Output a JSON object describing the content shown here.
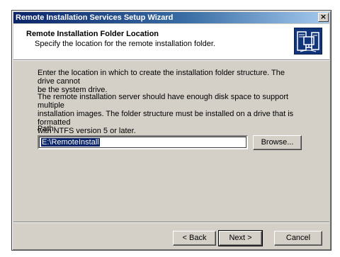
{
  "window": {
    "title": "Remote Installation Services Setup Wizard",
    "close_glyph": "×"
  },
  "header": {
    "title": "Remote Installation Folder Location",
    "subtitle": "Specify the location for the remote installation folder.",
    "icon": "wizard-computer-icon"
  },
  "content": {
    "paragraph1_line1": "Enter the location in which to create the installation folder structure. The drive cannot",
    "paragraph1_line2": "be the system drive.",
    "paragraph2_line1": "The remote installation server should have enough disk space to support multiple",
    "paragraph2_line2": "installation images. The folder structure must be installed on a drive that is formatted",
    "paragraph2_line3": "with NTFS version 5 or later.",
    "path_label": "Path:",
    "path_value": "E:\\RemoteInstall",
    "browse_label": "Browse..."
  },
  "footer": {
    "back_label": "< Back",
    "next_label": "Next >",
    "cancel_label": "Cancel"
  }
}
